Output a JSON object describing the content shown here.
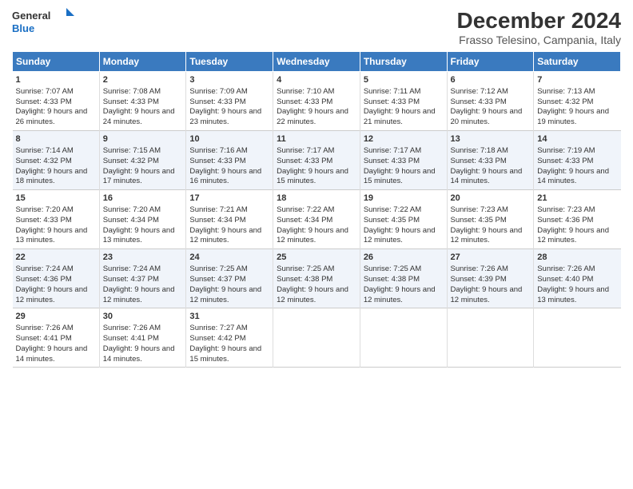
{
  "logo": {
    "line1": "General",
    "line2": "Blue",
    "icon_color": "#1a6fc4"
  },
  "title": "December 2024",
  "subtitle": "Frasso Telesino, Campania, Italy",
  "days_of_week": [
    "Sunday",
    "Monday",
    "Tuesday",
    "Wednesday",
    "Thursday",
    "Friday",
    "Saturday"
  ],
  "weeks": [
    [
      {
        "day": 1,
        "sunrise": "7:07 AM",
        "sunset": "4:33 PM",
        "daylight": "9 hours and 26 minutes."
      },
      {
        "day": 2,
        "sunrise": "7:08 AM",
        "sunset": "4:33 PM",
        "daylight": "9 hours and 24 minutes."
      },
      {
        "day": 3,
        "sunrise": "7:09 AM",
        "sunset": "4:33 PM",
        "daylight": "9 hours and 23 minutes."
      },
      {
        "day": 4,
        "sunrise": "7:10 AM",
        "sunset": "4:33 PM",
        "daylight": "9 hours and 22 minutes."
      },
      {
        "day": 5,
        "sunrise": "7:11 AM",
        "sunset": "4:33 PM",
        "daylight": "9 hours and 21 minutes."
      },
      {
        "day": 6,
        "sunrise": "7:12 AM",
        "sunset": "4:33 PM",
        "daylight": "9 hours and 20 minutes."
      },
      {
        "day": 7,
        "sunrise": "7:13 AM",
        "sunset": "4:32 PM",
        "daylight": "9 hours and 19 minutes."
      }
    ],
    [
      {
        "day": 8,
        "sunrise": "7:14 AM",
        "sunset": "4:32 PM",
        "daylight": "9 hours and 18 minutes."
      },
      {
        "day": 9,
        "sunrise": "7:15 AM",
        "sunset": "4:32 PM",
        "daylight": "9 hours and 17 minutes."
      },
      {
        "day": 10,
        "sunrise": "7:16 AM",
        "sunset": "4:33 PM",
        "daylight": "9 hours and 16 minutes."
      },
      {
        "day": 11,
        "sunrise": "7:17 AM",
        "sunset": "4:33 PM",
        "daylight": "9 hours and 15 minutes."
      },
      {
        "day": 12,
        "sunrise": "7:17 AM",
        "sunset": "4:33 PM",
        "daylight": "9 hours and 15 minutes."
      },
      {
        "day": 13,
        "sunrise": "7:18 AM",
        "sunset": "4:33 PM",
        "daylight": "9 hours and 14 minutes."
      },
      {
        "day": 14,
        "sunrise": "7:19 AM",
        "sunset": "4:33 PM",
        "daylight": "9 hours and 14 minutes."
      }
    ],
    [
      {
        "day": 15,
        "sunrise": "7:20 AM",
        "sunset": "4:33 PM",
        "daylight": "9 hours and 13 minutes."
      },
      {
        "day": 16,
        "sunrise": "7:20 AM",
        "sunset": "4:34 PM",
        "daylight": "9 hours and 13 minutes."
      },
      {
        "day": 17,
        "sunrise": "7:21 AM",
        "sunset": "4:34 PM",
        "daylight": "9 hours and 12 minutes."
      },
      {
        "day": 18,
        "sunrise": "7:22 AM",
        "sunset": "4:34 PM",
        "daylight": "9 hours and 12 minutes."
      },
      {
        "day": 19,
        "sunrise": "7:22 AM",
        "sunset": "4:35 PM",
        "daylight": "9 hours and 12 minutes."
      },
      {
        "day": 20,
        "sunrise": "7:23 AM",
        "sunset": "4:35 PM",
        "daylight": "9 hours and 12 minutes."
      },
      {
        "day": 21,
        "sunrise": "7:23 AM",
        "sunset": "4:36 PM",
        "daylight": "9 hours and 12 minutes."
      }
    ],
    [
      {
        "day": 22,
        "sunrise": "7:24 AM",
        "sunset": "4:36 PM",
        "daylight": "9 hours and 12 minutes."
      },
      {
        "day": 23,
        "sunrise": "7:24 AM",
        "sunset": "4:37 PM",
        "daylight": "9 hours and 12 minutes."
      },
      {
        "day": 24,
        "sunrise": "7:25 AM",
        "sunset": "4:37 PM",
        "daylight": "9 hours and 12 minutes."
      },
      {
        "day": 25,
        "sunrise": "7:25 AM",
        "sunset": "4:38 PM",
        "daylight": "9 hours and 12 minutes."
      },
      {
        "day": 26,
        "sunrise": "7:25 AM",
        "sunset": "4:38 PM",
        "daylight": "9 hours and 12 minutes."
      },
      {
        "day": 27,
        "sunrise": "7:26 AM",
        "sunset": "4:39 PM",
        "daylight": "9 hours and 12 minutes."
      },
      {
        "day": 28,
        "sunrise": "7:26 AM",
        "sunset": "4:40 PM",
        "daylight": "9 hours and 13 minutes."
      }
    ],
    [
      {
        "day": 29,
        "sunrise": "7:26 AM",
        "sunset": "4:41 PM",
        "daylight": "9 hours and 14 minutes."
      },
      {
        "day": 30,
        "sunrise": "7:26 AM",
        "sunset": "4:41 PM",
        "daylight": "9 hours and 14 minutes."
      },
      {
        "day": 31,
        "sunrise": "7:27 AM",
        "sunset": "4:42 PM",
        "daylight": "9 hours and 15 minutes."
      },
      null,
      null,
      null,
      null
    ]
  ],
  "labels": {
    "sunrise": "Sunrise:",
    "sunset": "Sunset:",
    "daylight": "Daylight:"
  }
}
